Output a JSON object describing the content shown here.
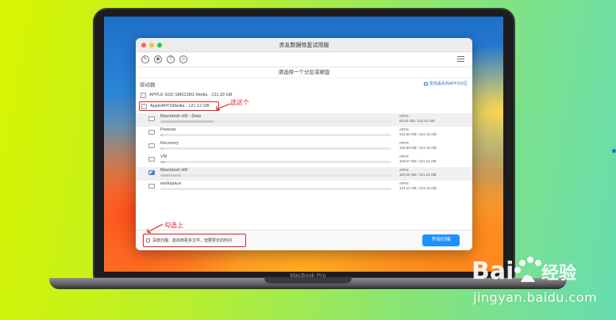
{
  "app": {
    "window_title": "赤友数据恢复试用版",
    "subheading": "请选择一个分区或硬盘",
    "section_title": "驱动器",
    "find_link": "查找丢失的APFS分区"
  },
  "drives": [
    {
      "label": "APPLE SSD SM0128G Media - 121.33 GB",
      "selected": false
    },
    {
      "label": "AppleAPFSMedia - 121.12 GB",
      "selected": true
    }
  ],
  "partitions": [
    {
      "name": "Macintosh HD - Data",
      "fs": "APFS",
      "size": "92.84 GB / 121.12 GB",
      "fill": 0.23,
      "icon": "drive-icon",
      "highlight": true
    },
    {
      "name": "Preboot",
      "fs": "APFS",
      "size": "121.04 GB / 121.12 GB",
      "fill": 0.01,
      "icon": "drive-icon",
      "highlight": false
    },
    {
      "name": "Recovery",
      "fs": "APFS",
      "size": "120.59 GB / 121.12 GB",
      "fill": 0.01,
      "icon": "drive-icon",
      "highlight": false
    },
    {
      "name": "VM",
      "fs": "APFS",
      "size": "118.97 GB / 121.12 GB",
      "fill": 0.02,
      "icon": "drive-icon",
      "highlight": false
    },
    {
      "name": "Macintosh HD",
      "fs": "APFS",
      "size": "110.52 GB / 121.12 GB",
      "fill": 0.09,
      "icon": "system-drive-icon",
      "highlight": true
    },
    {
      "name": "workspace",
      "fs": "APFS",
      "size": "121.12 GB / 121.12 GB",
      "fill": 0.0,
      "icon": "drive-icon",
      "highlight": false
    }
  ],
  "footer": {
    "deep_scan_label": "深度扫描：能找到更多文件，但要更长的时间",
    "start_button": "开始扫描"
  },
  "annotations": {
    "select_this": "选这个",
    "check_this": "勾选上"
  },
  "laptop_label": "MacBook Pro",
  "watermark": {
    "url": "jingyan.baidu.com"
  },
  "colors": {
    "accent": "#1e90ff",
    "annotation": "#e02020",
    "link": "#2f6fc4"
  }
}
